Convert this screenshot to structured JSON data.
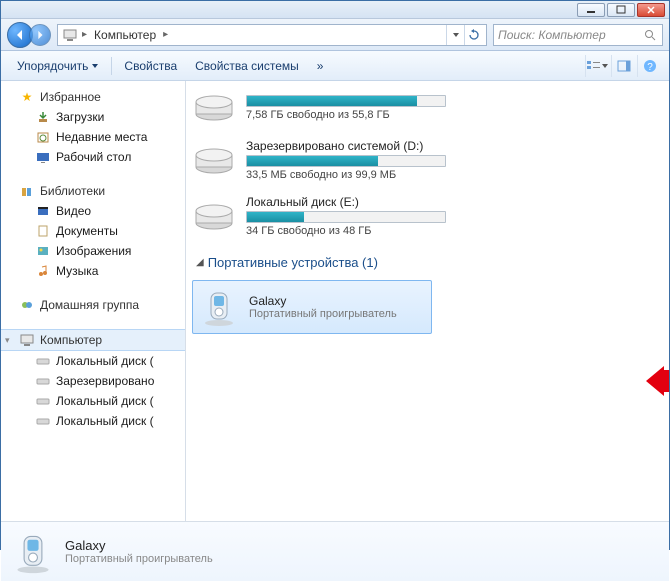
{
  "breadcrumb": {
    "segment": "Компьютер"
  },
  "search": {
    "placeholder": "Поиск: Компьютер"
  },
  "toolbar": {
    "organize": "Упорядочить",
    "properties": "Свойства",
    "system_properties": "Свойства системы",
    "overflow": "»"
  },
  "sidebar": {
    "favorites": {
      "label": "Избранное",
      "items": [
        "Загрузки",
        "Недавние места",
        "Рабочий стол"
      ]
    },
    "libraries": {
      "label": "Библиотеки",
      "items": [
        "Видео",
        "Документы",
        "Изображения",
        "Музыка"
      ]
    },
    "homegroup": {
      "label": "Домашняя группа"
    },
    "computer": {
      "label": "Компьютер",
      "items": [
        "Локальный диск (",
        "Зарезервировано",
        "Локальный диск (",
        "Локальный диск ("
      ]
    }
  },
  "drives": [
    {
      "name": "",
      "free": "7,58 ГБ свободно из 55,8 ГБ",
      "fill_pct": 86
    },
    {
      "name": "Зарезервировано системой (D:)",
      "free": "33,5 МБ свободно из 99,9 МБ",
      "fill_pct": 66
    },
    {
      "name": "Локальный диск (E:)",
      "free": "34 ГБ свободно из 48 ГБ",
      "fill_pct": 29
    }
  ],
  "section": {
    "portable_header": "Портативные устройства (1)"
  },
  "device": {
    "name": "Galaxy",
    "type": "Портативный проигрыватель"
  },
  "details": {
    "name": "Galaxy",
    "type": "Портативный проигрыватель"
  }
}
